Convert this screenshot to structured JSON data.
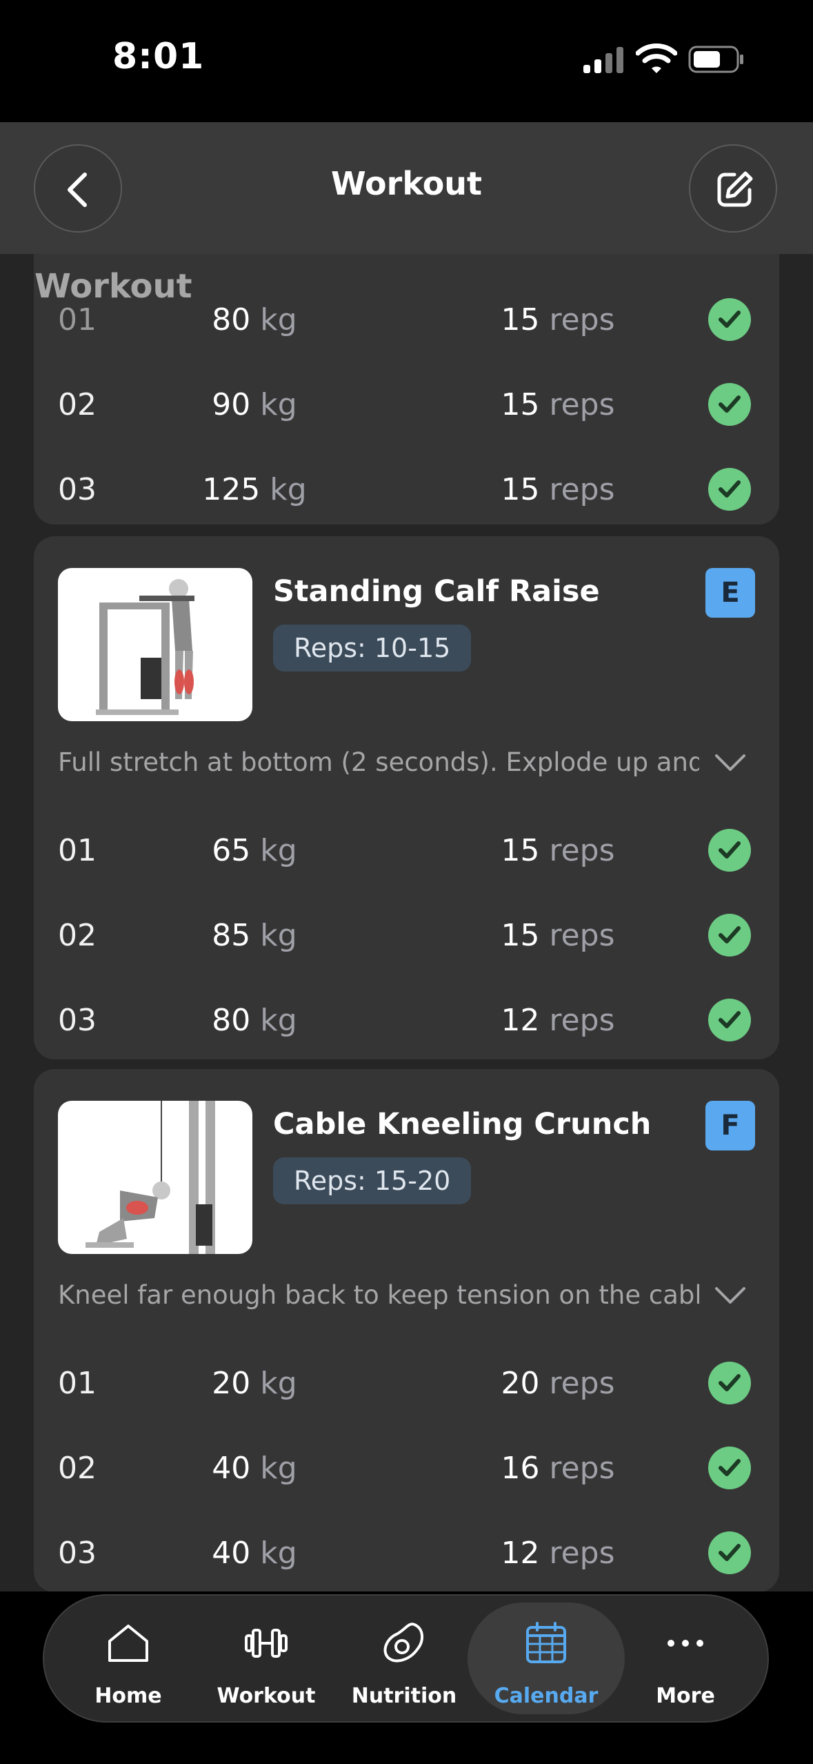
{
  "status": {
    "time": "8:01"
  },
  "header": {
    "title": "Workout"
  },
  "sticky_label": "Workout",
  "top_card": {
    "sets": [
      {
        "num": "01",
        "weight": "80",
        "reps": "15"
      },
      {
        "num": "02",
        "weight": "90",
        "reps": "15"
      },
      {
        "num": "03",
        "weight": "125",
        "reps": "15"
      }
    ]
  },
  "units": {
    "kg": "kg",
    "reps": "reps"
  },
  "exercises": [
    {
      "name": "Standing Calf Raise",
      "reps_label": "Reps: 10-15",
      "letter": "E",
      "note": "Full stretch at bottom (2 seconds). Explode up and...",
      "sets": [
        {
          "num": "01",
          "weight": "65",
          "reps": "15"
        },
        {
          "num": "02",
          "weight": "85",
          "reps": "15"
        },
        {
          "num": "03",
          "weight": "80",
          "reps": "12"
        }
      ]
    },
    {
      "name": "Cable Kneeling Crunch",
      "reps_label": "Reps: 15-20",
      "letter": "F",
      "note": "Kneel far enough back to keep tension on the cabl...",
      "sets": [
        {
          "num": "01",
          "weight": "20",
          "reps": "20"
        },
        {
          "num": "02",
          "weight": "40",
          "reps": "16"
        },
        {
          "num": "03",
          "weight": "40",
          "reps": "12"
        }
      ]
    }
  ],
  "tabs": [
    {
      "label": "Home",
      "icon": "home-icon"
    },
    {
      "label": "Workout",
      "icon": "dumbbell-icon"
    },
    {
      "label": "Nutrition",
      "icon": "avocado-icon"
    },
    {
      "label": "Calendar",
      "icon": "calendar-icon",
      "active": true
    },
    {
      "label": "More",
      "icon": "more-icon"
    }
  ],
  "colors": {
    "accent": "#58aaf0",
    "check": "#6ccc84",
    "card": "#353535",
    "background": "#252525"
  }
}
